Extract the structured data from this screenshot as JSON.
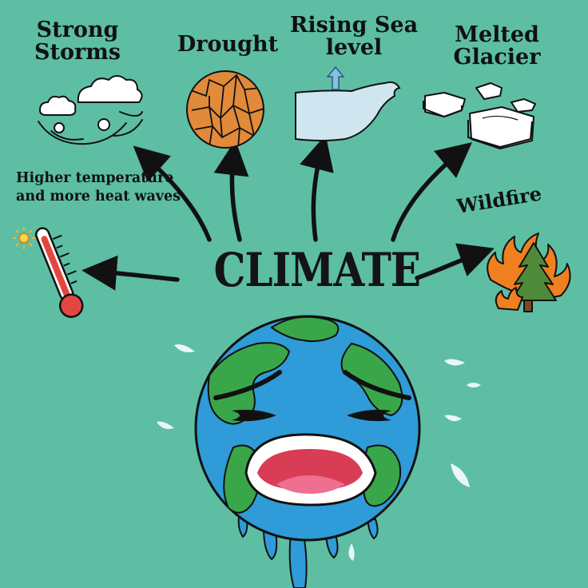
{
  "diagram": {
    "center": "CLIMATE",
    "effects": [
      {
        "id": "strong-storms",
        "label": "Strong Storms",
        "icon": "storm-icon"
      },
      {
        "id": "drought",
        "label": "Drought",
        "icon": "cracked-earth-icon"
      },
      {
        "id": "rising-sea-level",
        "label": "Rising Sea level",
        "icon": "rising-wave-icon"
      },
      {
        "id": "melted-glacier",
        "label": "Melted Glacier",
        "icon": "melting-ice-icon"
      },
      {
        "id": "heat-waves",
        "label": "Higher temperature and more heat waves",
        "icon": "thermometer-icon"
      },
      {
        "id": "wildfire",
        "label": "Wildfire",
        "icon": "burning-tree-icon"
      }
    ],
    "illustration": "crying-earth-icon"
  },
  "colors": {
    "background": "#5dbea3",
    "ocean": "#2f9bd8",
    "land": "#3aa64a",
    "outline": "#111111",
    "drought": "#e08a3a",
    "sea": "#cfe6f0",
    "fire": "#f07f1f",
    "tree": "#4f8a3a",
    "thermometer": "#e2473f"
  }
}
